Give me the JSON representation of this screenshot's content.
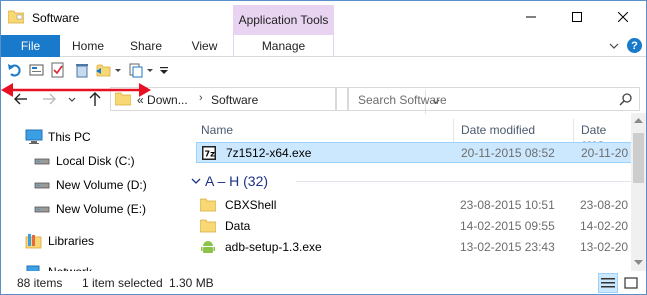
{
  "window": {
    "title": "Software",
    "context_tab": "Application Tools",
    "controls": [
      "minimize-icon",
      "maximize-icon",
      "close-icon"
    ]
  },
  "ribbon": {
    "tabs": [
      "File",
      "Home",
      "Share",
      "View",
      "Manage"
    ],
    "help": "?"
  },
  "address": {
    "crumb1": "Down...",
    "prefix": "«",
    "separator": "›",
    "crumb2": "Software"
  },
  "search": {
    "placeholder": "Search Software"
  },
  "nav_pane": {
    "items": [
      {
        "label": "This PC",
        "icon": "this-pc-icon"
      },
      {
        "label": "Local Disk (C:)",
        "icon": "drive-icon"
      },
      {
        "label": "New Volume (D:)",
        "icon": "drive-icon"
      },
      {
        "label": "New Volume (E:)",
        "icon": "drive-icon"
      },
      {
        "label": "Libraries",
        "icon": "libraries-icon"
      },
      {
        "label": "Network",
        "icon": "network-icon"
      }
    ]
  },
  "file_list": {
    "columns": [
      "Name",
      "Date modified",
      "Date crea"
    ],
    "top_rows": [
      {
        "name": "7z1512-x64.exe",
        "date": "20-11-2015 08:52",
        "created": "20-11-20"
      }
    ],
    "group": {
      "title": "A – H (32)"
    },
    "group_rows": [
      {
        "name": "CBXShell",
        "date": "23-08-2015 10:51",
        "created": "23-08-20"
      },
      {
        "name": "Data",
        "date": "14-02-2015 09:55",
        "created": "14-02-20"
      },
      {
        "name": "adb-setup-1.3.exe",
        "date": "13-02-2015 23:43",
        "created": "13-02-20"
      }
    ]
  },
  "status": {
    "items_count": "88 items",
    "selection": "1 item selected",
    "size": "1.30 MB"
  },
  "colors": {
    "accent": "#1979ca",
    "context_tab": "#e8d4f0",
    "selection": "#cce8ff",
    "group_title": "#1e3287",
    "red_arrow": "#e81123"
  }
}
